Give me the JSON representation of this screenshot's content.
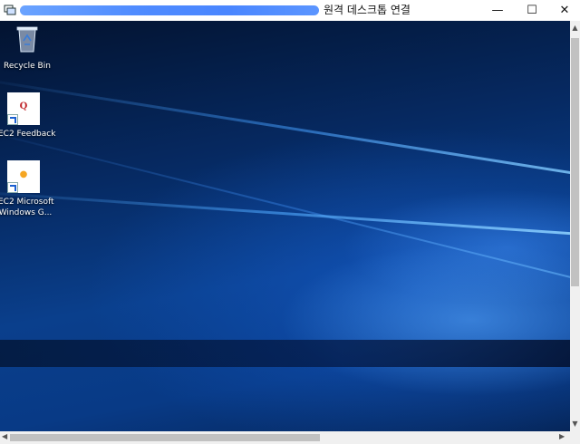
{
  "window": {
    "title": "원격 데스크톱 연결",
    "buttons": {
      "minimize": "—",
      "maximize": "☐",
      "close": "✕"
    }
  },
  "desktop": {
    "icons": [
      {
        "label": "Recycle Bin",
        "icon": "recycle-bin-icon"
      },
      {
        "label": "EC2 Feedback",
        "icon": "ec2-feedback-icon",
        "glyph": "Q"
      },
      {
        "label_line1": "EC2 Microsoft",
        "label_line2": "Windows G...",
        "icon": "ec2-microsoft-windows-icon",
        "glyph": "●"
      }
    ]
  },
  "scrollbars": {
    "vertical": {
      "up": "▲",
      "down": "▼"
    },
    "horizontal": {
      "left": "◀",
      "right": "▶"
    }
  },
  "colors": {
    "redaction": "#4f8bff",
    "wallpaper_dark": "#031330",
    "wallpaper_light": "#2f7fe0",
    "feedback_glyph": "#c0282d",
    "ms_glyph": "#f5a623"
  }
}
